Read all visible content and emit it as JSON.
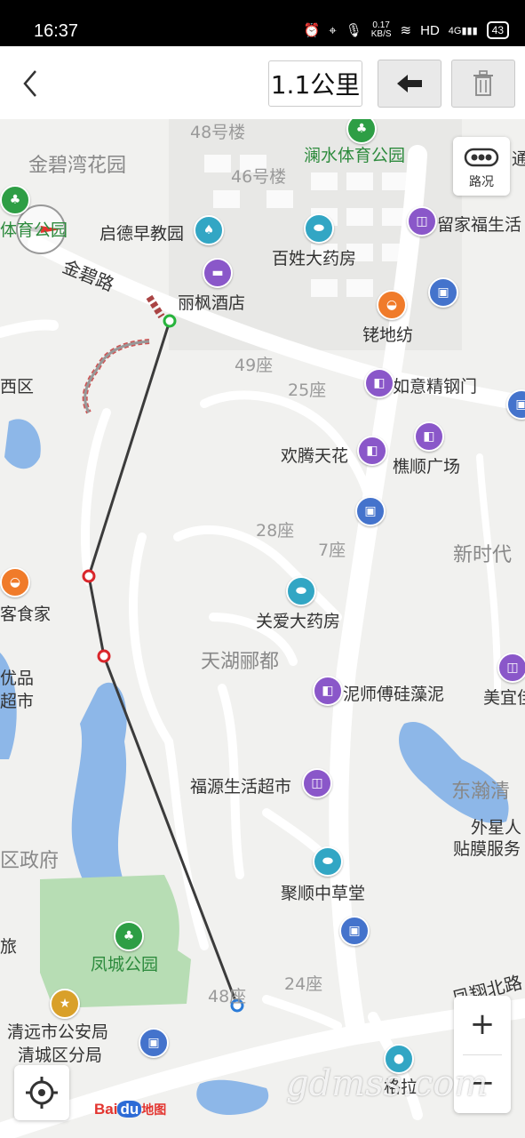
{
  "status_bar": {
    "time": "16:37",
    "net_speed": "0.17",
    "net_unit": "KB/S",
    "hd": "HD",
    "network": "4G",
    "battery": "43"
  },
  "toolbar": {
    "distance": "1.1公里",
    "undo_icon": "arrow-left-icon",
    "delete_icon": "trash-icon"
  },
  "map": {
    "traffic_label": "路况",
    "zoom_in": "+",
    "zoom_out": "−",
    "logo": {
      "bai": "Bai",
      "du": "du",
      "ditu": "地图"
    },
    "watermark": "gdmss.com",
    "roads": {
      "jinbi": "金碧路",
      "fengxiang": "凤翔北路"
    },
    "places": {
      "jinbiwan": "金碧湾花园",
      "lou48": "48号楼",
      "lou46": "46号楼",
      "lanshui": "澜水体育公园",
      "tiyugongyuan": "体育公园",
      "qide": "启德早教园",
      "baixing": "百姓大药房",
      "liujia": "留家福生活",
      "tong": "通",
      "lifeng": "丽枫酒店",
      "laodifang": "铑地纺",
      "xiqu": "西区",
      "zuo49": "49座",
      "zuo25": "25座",
      "ruyi": "如意精钢门",
      "huanteng": "欢腾天花",
      "qiaoshun": "樵顺广场",
      "zuo28": "28座",
      "zuo7": "7座",
      "xinshidai": "新时代",
      "kejia": "客食家",
      "guanai": "关爱大药房",
      "tianhu": "天湖郦都",
      "pinpin": "优品",
      "chaoshi": "超市",
      "nishi": "泥师傅硅藻泥",
      "meiyi": "美宜佳",
      "fuyuan": "福源生活超市",
      "dongying": "东瀚清",
      "waixing1": "外星人",
      "waixing2": "贴膜服务",
      "zhengfu": "区政府",
      "jushun": "聚顺中草堂",
      "lv": "旅",
      "fengcheng": "凤城公园",
      "zuo48": "48座",
      "zuo24": "24座",
      "gongan1": "清远市公安局",
      "gongan2": "清城区分局",
      "bottom_poi": "格拉"
    }
  },
  "colors": {
    "route": "#3b3b3b",
    "start_node": "#27b43c",
    "mid_node": "#d9262b",
    "end_node": "#2a7bd8",
    "water": "#8db7e8",
    "park": "#b7ddb4",
    "poi_purple": "#8a57c9",
    "poi_teal": "#32a6c4",
    "poi_blue": "#4473cc",
    "poi_orange": "#f07b2a"
  }
}
